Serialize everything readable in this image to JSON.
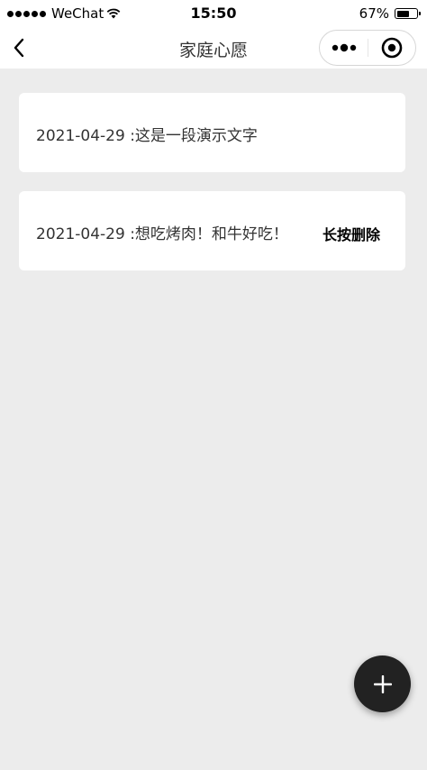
{
  "status_bar": {
    "carrier": "WeChat",
    "time": "15:50",
    "battery_percent": "67%",
    "battery_level": 0.67
  },
  "nav": {
    "title": "家庭心愿",
    "back_icon": "chevron-left-icon",
    "more_icon": "more-dots-icon",
    "close_icon": "target-close-icon"
  },
  "wishes": [
    {
      "text": "2021-04-29 :这是一段演示文字",
      "action": ""
    },
    {
      "text": "2021-04-29 :想吃烤肉！和牛好吃！",
      "action": "长按删除"
    }
  ],
  "fab": {
    "icon": "plus-icon",
    "color": "#222222"
  },
  "colors": {
    "background": "#ececec",
    "card": "#ffffff",
    "text": "#333333"
  }
}
